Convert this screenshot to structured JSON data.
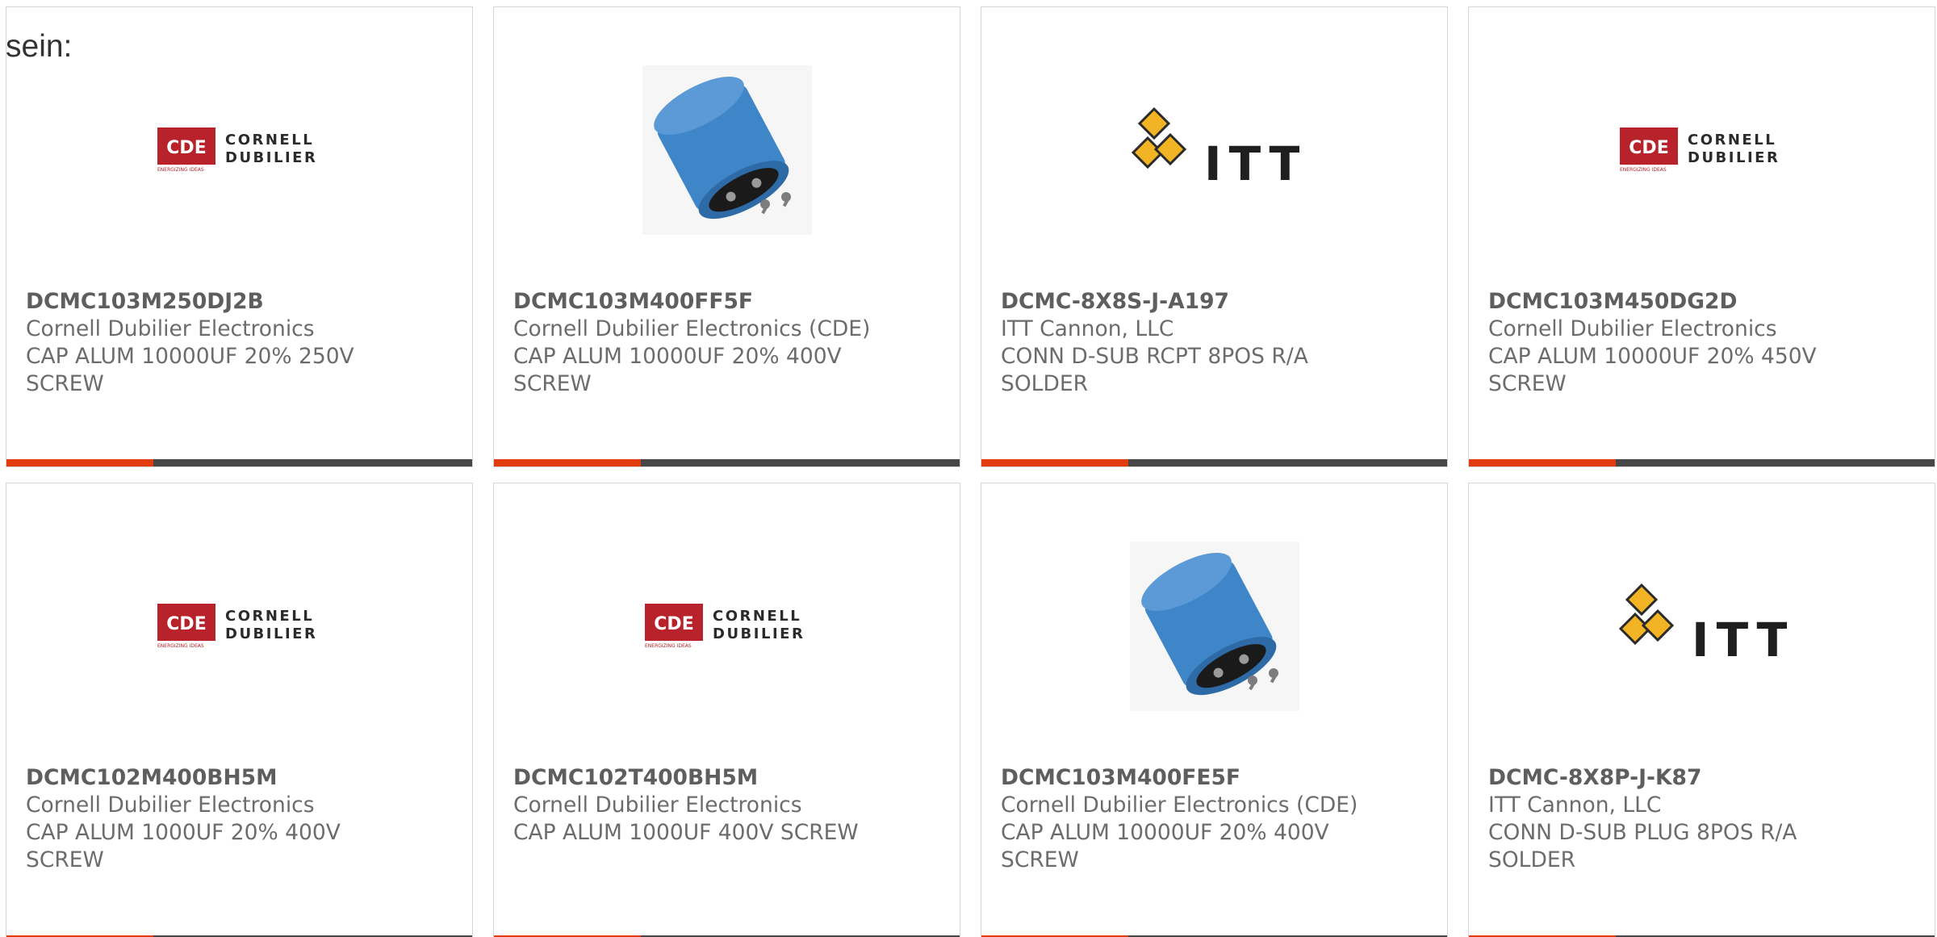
{
  "intro_text": "sein:",
  "colors": {
    "accent": "#e23c0e",
    "bar": "#474747",
    "cde_red": "#b8222a",
    "itt_gold": "#f2b424",
    "capacitor_blue": "#3f86c9"
  },
  "products": [
    {
      "part_number": "DCMC103M250DJ2B",
      "manufacturer": "Cornell Dubilier Electronics",
      "desc_line1": "CAP ALUM 10000UF 20% 250V",
      "desc_line2": "SCREW",
      "image": "cde-logo",
      "logo_badge": "CDE",
      "logo_line1": "CORNELL",
      "logo_line2": "DUBILIER",
      "logo_tagline": "ENERGIZING IDEAS"
    },
    {
      "part_number": "DCMC103M400FF5F",
      "manufacturer": "Cornell Dubilier Electronics (CDE)",
      "desc_line1": "CAP ALUM 10000UF 20% 400V",
      "desc_line2": "SCREW",
      "image": "capacitor-photo"
    },
    {
      "part_number": "DCMC-8X8S-J-A197",
      "manufacturer": "ITT Cannon, LLC",
      "desc_line1": "CONN D-SUB RCPT 8POS R/A",
      "desc_line2": "SOLDER",
      "image": "itt-logo",
      "logo_text": "ITT"
    },
    {
      "part_number": "DCMC103M450DG2D",
      "manufacturer": "Cornell Dubilier Electronics",
      "desc_line1": "CAP ALUM 10000UF 20% 450V",
      "desc_line2": "SCREW",
      "image": "cde-logo",
      "logo_badge": "CDE",
      "logo_line1": "CORNELL",
      "logo_line2": "DUBILIER",
      "logo_tagline": "ENERGIZING IDEAS"
    },
    {
      "part_number": "DCMC102M400BH5M",
      "manufacturer": "Cornell Dubilier Electronics",
      "desc_line1": "CAP ALUM 1000UF 20% 400V",
      "desc_line2": "SCREW",
      "image": "cde-logo",
      "logo_badge": "CDE",
      "logo_line1": "CORNELL",
      "logo_line2": "DUBILIER",
      "logo_tagline": "ENERGIZING IDEAS"
    },
    {
      "part_number": "DCMC102T400BH5M",
      "manufacturer": "Cornell Dubilier Electronics",
      "desc_line1": "CAP ALUM 1000UF 400V SCREW",
      "desc_line2": "",
      "image": "cde-logo",
      "logo_badge": "CDE",
      "logo_line1": "CORNELL",
      "logo_line2": "DUBILIER",
      "logo_tagline": "ENERGIZING IDEAS"
    },
    {
      "part_number": "DCMC103M400FE5F",
      "manufacturer": "Cornell Dubilier Electronics (CDE)",
      "desc_line1": "CAP ALUM 10000UF 20% 400V",
      "desc_line2": "SCREW",
      "image": "capacitor-photo"
    },
    {
      "part_number": "DCMC-8X8P-J-K87",
      "manufacturer": "ITT Cannon, LLC",
      "desc_line1": "CONN D-SUB PLUG 8POS R/A",
      "desc_line2": "SOLDER",
      "image": "itt-logo",
      "logo_text": "ITT"
    }
  ]
}
